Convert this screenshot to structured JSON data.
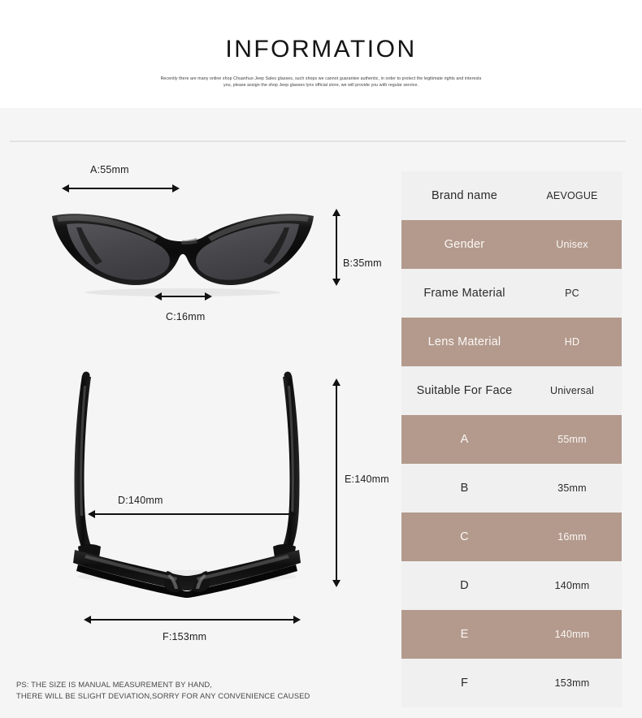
{
  "header": {
    "title": "INFORMATION",
    "subtitle": "Recently there are many online shop Chuanhuo Jeep Sales glasses, such shops we cannot guarantee authentic, in order to protect the legitimate rights and interests you, please assign the shop Jeep glasses lynx official store, we will provide you with regular service."
  },
  "diagram": {
    "front_view": {
      "alt": "cat-eye sunglasses front view",
      "labels": {
        "a": "A:55mm",
        "b": "B:35mm",
        "c": "C:16mm"
      }
    },
    "top_view": {
      "alt": "sunglasses top view with temples open",
      "labels": {
        "d": "D:140mm",
        "e": "E:140mm",
        "f": "F:153mm"
      }
    }
  },
  "ps_note": {
    "line1": "PS: THE SIZE IS MANUAL MEASUREMENT BY HAND,",
    "line2": "THERE WILL BE SLIGHT DEVIATION,SORRY FOR ANY CONVENIENCE CAUSED"
  },
  "spec_table": {
    "rows": [
      {
        "key": "Brand name",
        "value": "AEVOGUE",
        "style": "light"
      },
      {
        "key": "Gender",
        "value": "Unisex",
        "style": "dark"
      },
      {
        "key": "Frame Material",
        "value": "PC",
        "style": "light"
      },
      {
        "key": "Lens Material",
        "value": "HD",
        "style": "dark"
      },
      {
        "key": "Suitable For Face",
        "value": "Universal",
        "style": "light"
      },
      {
        "key": "A",
        "value": "55mm",
        "style": "dark"
      },
      {
        "key": "B",
        "value": "35mm",
        "style": "light"
      },
      {
        "key": "C",
        "value": "16mm",
        "style": "dark"
      },
      {
        "key": "D",
        "value": "140mm",
        "style": "light"
      },
      {
        "key": "E",
        "value": "140mm",
        "style": "dark"
      },
      {
        "key": "F",
        "value": "153mm",
        "style": "light"
      }
    ]
  },
  "colors": {
    "page_background": "#f5f5f5",
    "header_background": "#ffffff",
    "row_light": "#f0f0f0",
    "row_dark": "#b39a8d",
    "divider": "#e2e2e2",
    "frame_black": "#111111",
    "lens_gray": "#4a4a4e"
  }
}
